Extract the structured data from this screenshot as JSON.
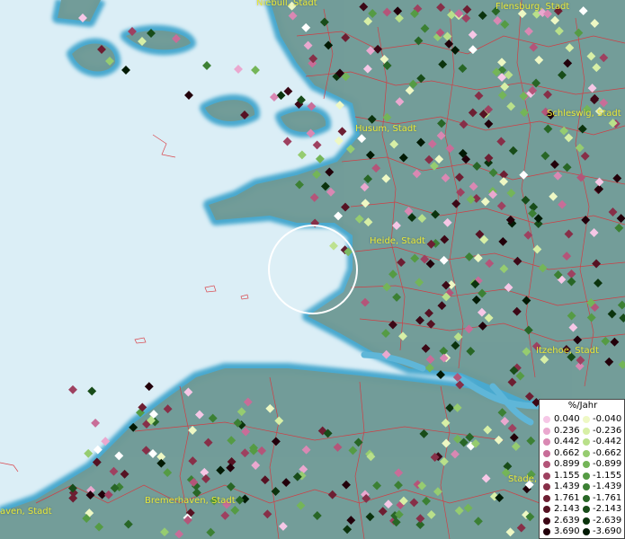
{
  "map": {
    "cities": [
      {
        "id": "niebuell",
        "label": "Niebüll, Stadt"
      },
      {
        "id": "flensburg",
        "label": "Flensburg, Stadt"
      },
      {
        "id": "schleswig",
        "label": "Schleswig, Stadt"
      },
      {
        "id": "husum",
        "label": "Husum, Stadt"
      },
      {
        "id": "heide",
        "label": "Heide, Stadt"
      },
      {
        "id": "itzehoe",
        "label": "Itzehoe, Stadt"
      },
      {
        "id": "stade",
        "label": "Stade,"
      },
      {
        "id": "bremerhaven",
        "label": "Bremerhaven, Stadt"
      },
      {
        "id": "cuxhaven",
        "label": "aven, Stadt"
      }
    ],
    "colors": {
      "water": "#dbeef6",
      "land": "#6f9a96",
      "boundary": "#d9353c",
      "label": "#e9e93a"
    }
  },
  "legend": {
    "unit": "%/Jahr",
    "positive": [
      {
        "label": "0.040",
        "color": "#f6c7e6"
      },
      {
        "label": "0.236",
        "color": "#eaa8cf"
      },
      {
        "label": "0.442",
        "color": "#d988b3"
      },
      {
        "label": "0.662",
        "color": "#c86d98"
      },
      {
        "label": "0.899",
        "color": "#b45579"
      },
      {
        "label": "1.155",
        "color": "#9e4160"
      },
      {
        "label": "1.439",
        "color": "#872f48"
      },
      {
        "label": "1.761",
        "color": "#6d1e32"
      },
      {
        "label": "2.143",
        "color": "#561223"
      },
      {
        "label": "2.639",
        "color": "#3c0816"
      },
      {
        "label": "3.690",
        "color": "#22000a"
      }
    ],
    "negative": [
      {
        "label": "-0.040",
        "color": "#eef8c4"
      },
      {
        "label": "-0.236",
        "color": "#d7efa6"
      },
      {
        "label": "-0.442",
        "color": "#b9e08a"
      },
      {
        "label": "-0.662",
        "color": "#96cc70"
      },
      {
        "label": "-0.899",
        "color": "#74b558"
      },
      {
        "label": "-1.155",
        "color": "#559b44"
      },
      {
        "label": "-1.439",
        "color": "#3c8034"
      },
      {
        "label": "-1.761",
        "color": "#286626"
      },
      {
        "label": "-2.143",
        "color": "#184c19"
      },
      {
        "label": "-2.639",
        "color": "#0b330d"
      },
      {
        "label": "-3.690",
        "color": "#021a04"
      }
    ]
  }
}
